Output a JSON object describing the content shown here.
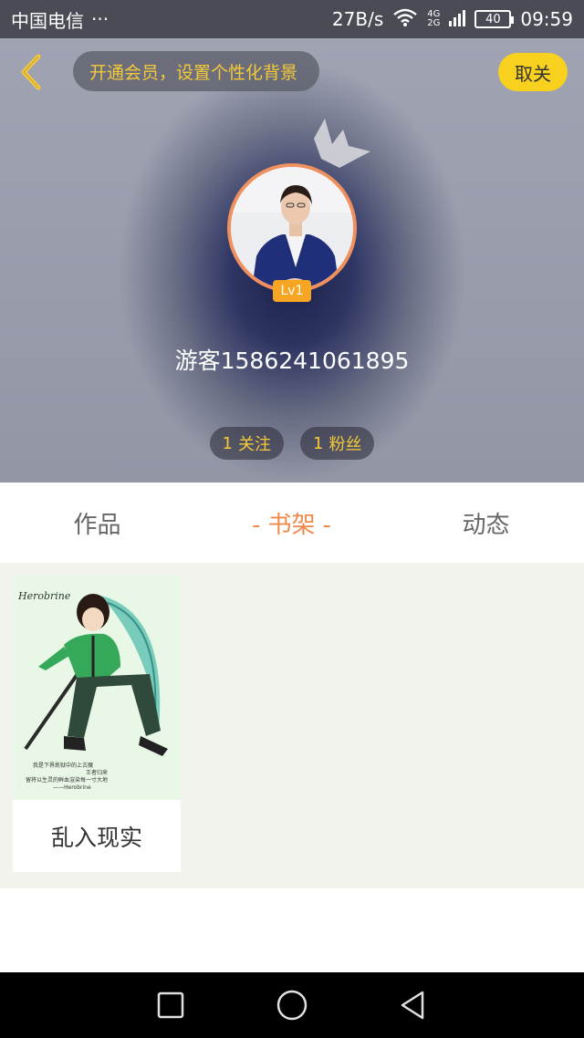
{
  "status_bar": {
    "carrier": "中国电信",
    "more": "···",
    "speed": "27B/s",
    "net_top": "4G",
    "net_bottom": "2G",
    "battery": "40",
    "time": "09:59"
  },
  "header": {
    "vip_banner": "开通会员，设置个性化背景",
    "unfollow_label": "取关",
    "level": "Lv1",
    "username": "游客1586241061895",
    "following": {
      "count": "1",
      "label": "关注"
    },
    "followers": {
      "count": "1",
      "label": "粉丝"
    }
  },
  "tabs": [
    {
      "label": "作品",
      "active": false
    },
    {
      "label": "书架",
      "active": true,
      "dash": "-"
    },
    {
      "label": "动态",
      "active": false
    }
  ],
  "books": [
    {
      "title": "乱入现实",
      "cover_text_top": "Herobrine",
      "cover_lines": [
        "我是下界炼狱中的上古魔",
        "王者归来",
        "留将以生灵的鲜血渲染每一寸大地",
        "——Herobrine"
      ]
    }
  ],
  "colors": {
    "accent_orange": "#f08a4b",
    "accent_yellow": "#f7d11d",
    "gold_text": "#f5c93a",
    "level_badge": "#f6a623"
  },
  "icons": {
    "back": "chevron-left-icon",
    "crown": "crown-icon",
    "nav_recent": "square-icon",
    "nav_home": "circle-icon",
    "nav_back": "triangle-back-icon",
    "wifi": "wifi-icon",
    "signal": "signal-icon",
    "battery": "battery-icon"
  }
}
